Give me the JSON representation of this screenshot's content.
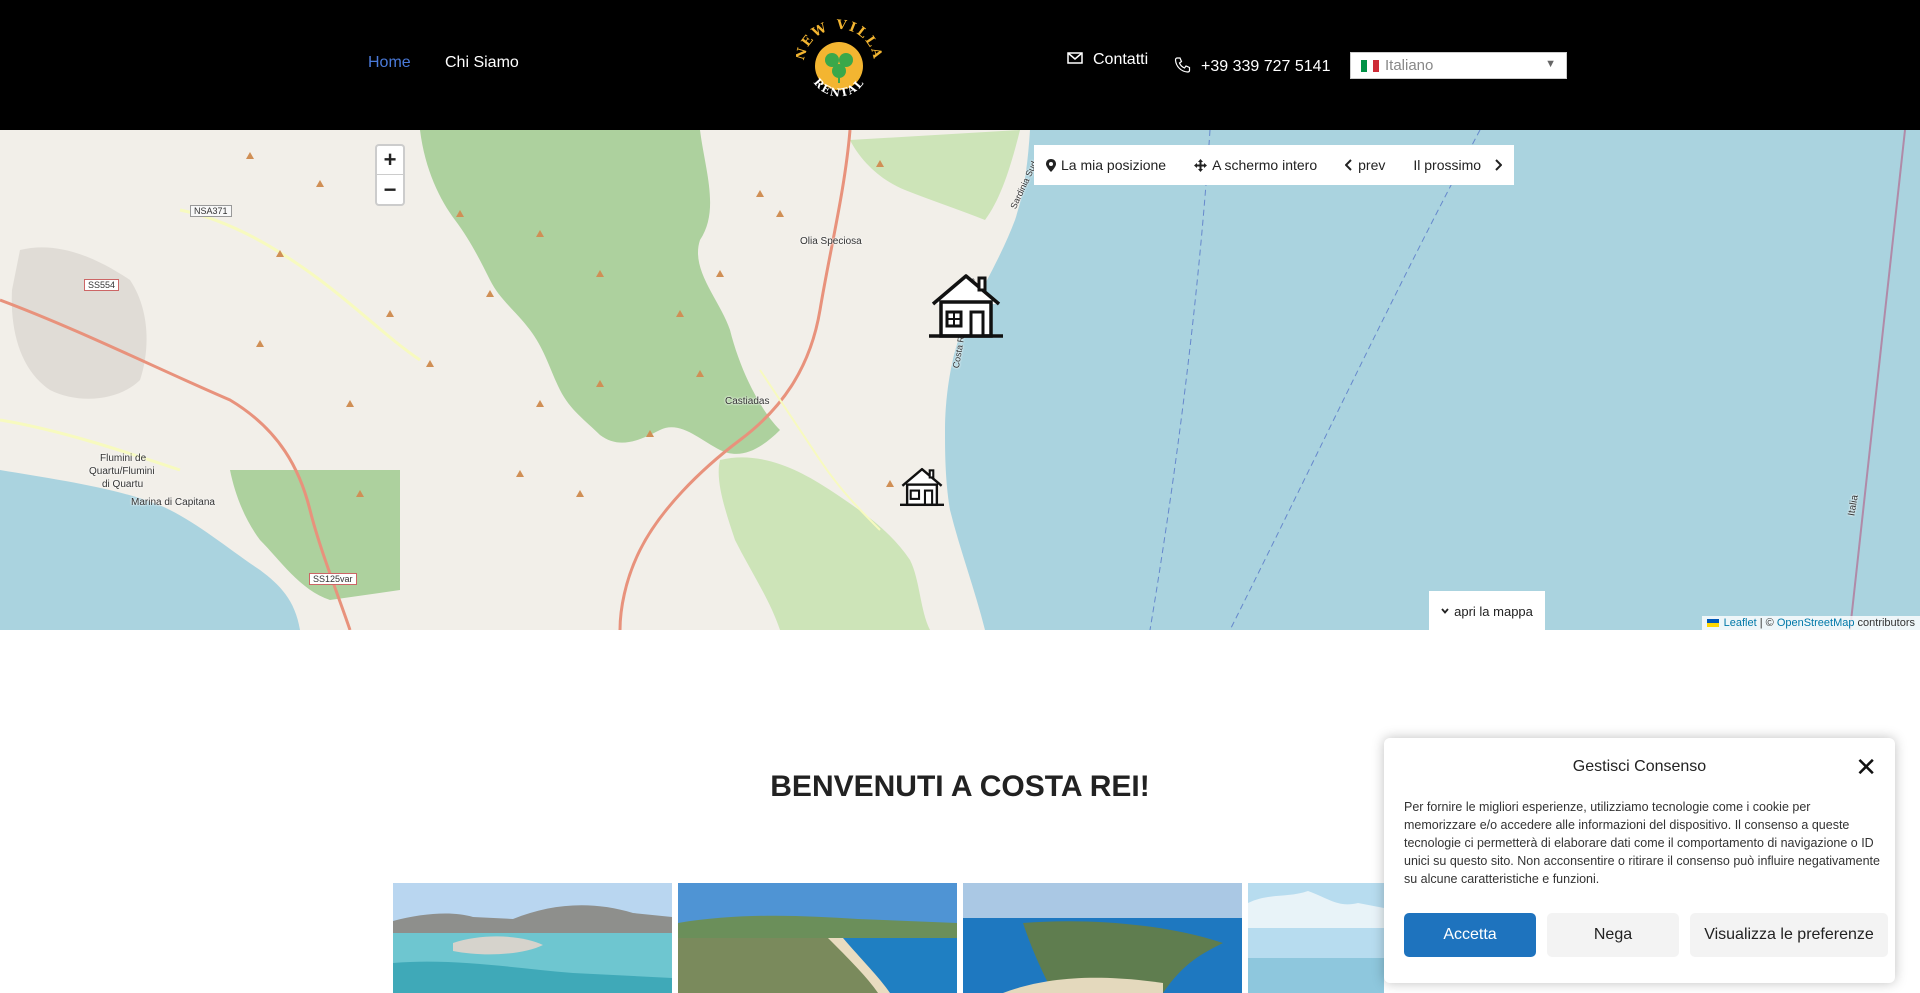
{
  "header": {
    "nav": [
      {
        "label": "Home",
        "active": true
      },
      {
        "label": "Chi Siamo",
        "active": false
      }
    ],
    "logo_text_top": "NEW VILLA",
    "logo_text_bottom": "RENTAL",
    "contact_label": "Contatti",
    "phone": "+39 339 727 5141",
    "language": "Italiano"
  },
  "map": {
    "zoom_in": "+",
    "zoom_out": "−",
    "toolbar": {
      "my_position": "La mia posizione",
      "fullscreen": "A schermo intero",
      "prev": "prev",
      "next": "Il prossimo"
    },
    "open_map": "apri la mappa",
    "attribution": {
      "leaflet": "Leaflet",
      "sep": " | © ",
      "osm": "OpenStreetMap",
      "suffix": " contributors"
    },
    "places": {
      "olia": "Olia Speciosa",
      "castiadas": "Castiadas",
      "flumini": "Flumini de",
      "flumini2": "Quartu/Flumini",
      "flumini3": "di Quartu",
      "marina": "Marina di Capitana",
      "italia": "Italia",
      "sardinia": "Sardinia Sud",
      "costarei": "Costa Rei di Castiadas"
    },
    "roads": {
      "nsa": "NSA371",
      "ss554": "SS554",
      "ss125": "SS125var"
    }
  },
  "content": {
    "welcome": "BENVENUTI A COSTA REI!"
  },
  "consent": {
    "title": "Gestisci Consenso",
    "body": "Per fornire le migliori esperienze, utilizziamo tecnologie come i cookie per memorizzare e/o accedere alle informazioni del dispositivo. Il consenso a queste tecnologie ci permetterà di elaborare dati come il comportamento di navigazione o ID unici su questo sito. Non acconsentire o ritirare il consenso può influire negativamente su alcune caratteristiche e funzioni.",
    "accept": "Accetta",
    "deny": "Nega",
    "preferences": "Visualizza le preferenze"
  }
}
